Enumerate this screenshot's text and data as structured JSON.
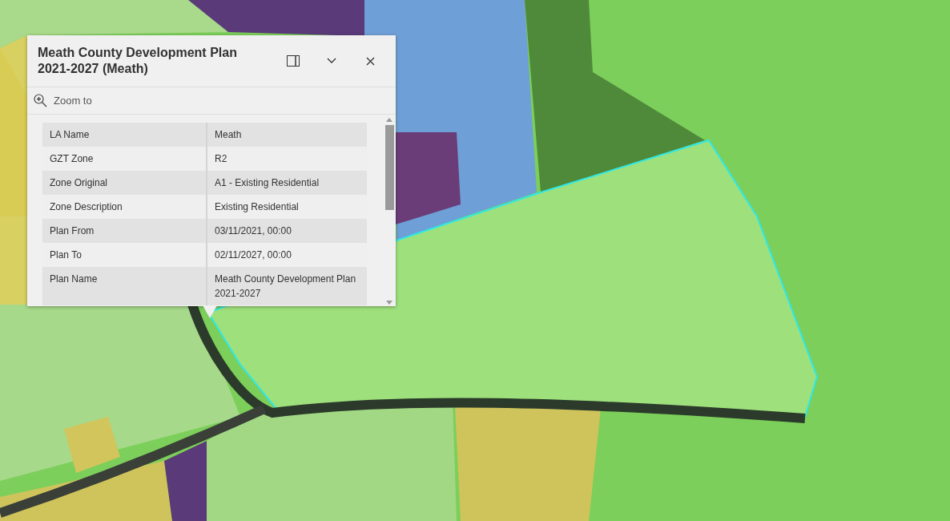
{
  "popup": {
    "title": "Meath County Development Plan 2021-2027 (Meath)",
    "action": "Zoom to",
    "fields": [
      {
        "label": "LA Name",
        "value": "Meath"
      },
      {
        "label": "GZT Zone",
        "value": "R2"
      },
      {
        "label": "Zone Original",
        "value": "A1 - Existing Residential"
      },
      {
        "label": "Zone Description",
        "value": "Existing Residential"
      },
      {
        "label": "Plan From",
        "value": "03/11/2021, 00:00"
      },
      {
        "label": "Plan To",
        "value": "02/11/2027, 00:00"
      },
      {
        "label": "Plan Name",
        "value": "Meath County Development Plan 2021-2027"
      }
    ]
  }
}
